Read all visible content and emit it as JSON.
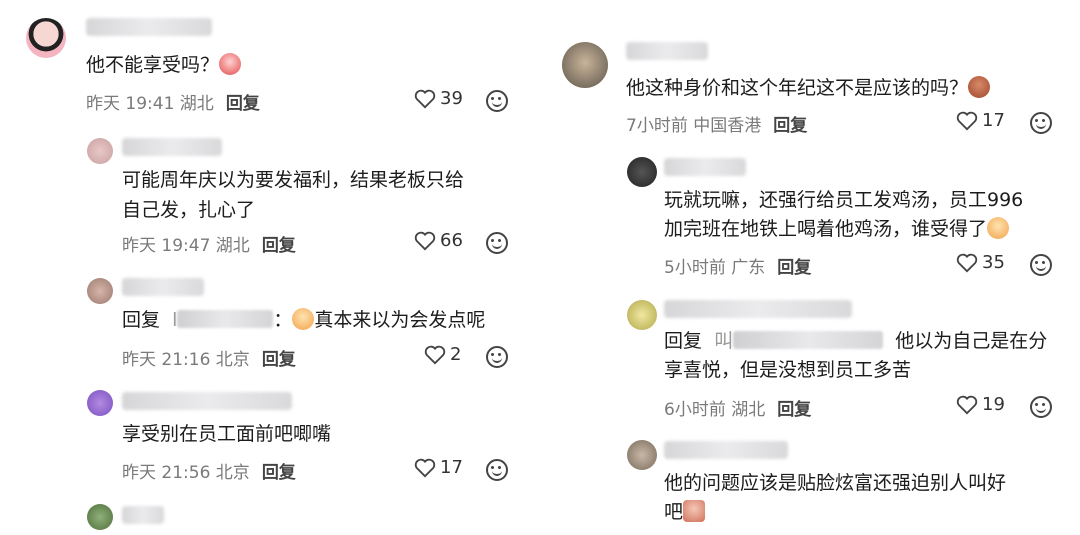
{
  "left": [
    {
      "id": "c1",
      "text": "他不能享受吗？",
      "meta_time": "昨天 19:41 湖北",
      "reply": "回复",
      "likes": "39"
    },
    {
      "id": "c2",
      "text1": "可能周年庆以为要发福利，结果老板只给",
      "text2": "自己发，扎心了",
      "meta_time": "昨天 19:47 湖北",
      "reply": "回复",
      "likes": "66"
    },
    {
      "id": "c3",
      "reply_prefix": "回复",
      "mention_initial": "l",
      "colon": "：",
      "text": "真本来以为会发点呢",
      "meta_time": "昨天 21:16 北京",
      "reply": "回复",
      "likes": "2"
    },
    {
      "id": "c4",
      "text": "享受别在员工面前吧唧嘴",
      "meta_time": "昨天 21:56 北京",
      "reply": "回复",
      "likes": "17"
    }
  ],
  "right": [
    {
      "id": "r1",
      "text": "他这种身价和这个年纪这不是应该的吗？",
      "meta_time": "7小时前 中国香港",
      "reply": "回复",
      "likes": "17"
    },
    {
      "id": "r2",
      "text1": "玩就玩嘛，还强行给员工发鸡汤，员工996",
      "text2": "加完班在地铁上喝着他鸡汤，谁受得了",
      "meta_time": "5小时前 广东",
      "reply": "回复",
      "likes": "35"
    },
    {
      "id": "r3",
      "reply_prefix": "回复",
      "mention_initial": "叫",
      "text1": "他以为自己是在分",
      "text2": "享喜悦，但是没想到员工多苦",
      "meta_time": "6小时前 湖北",
      "reply": "回复",
      "likes": "19"
    },
    {
      "id": "r4",
      "text1": "他的问题应该是贴脸炫富还强迫别人叫好",
      "text2": "吧",
      "meta_time": "",
      "reply": "",
      "likes": ""
    }
  ],
  "icons": {
    "like": "heart-outline-icon",
    "react": "smile-icon"
  },
  "colors": {
    "text": "#1c1c1c",
    "meta": "#7a7a7a",
    "reply": "#444444"
  }
}
